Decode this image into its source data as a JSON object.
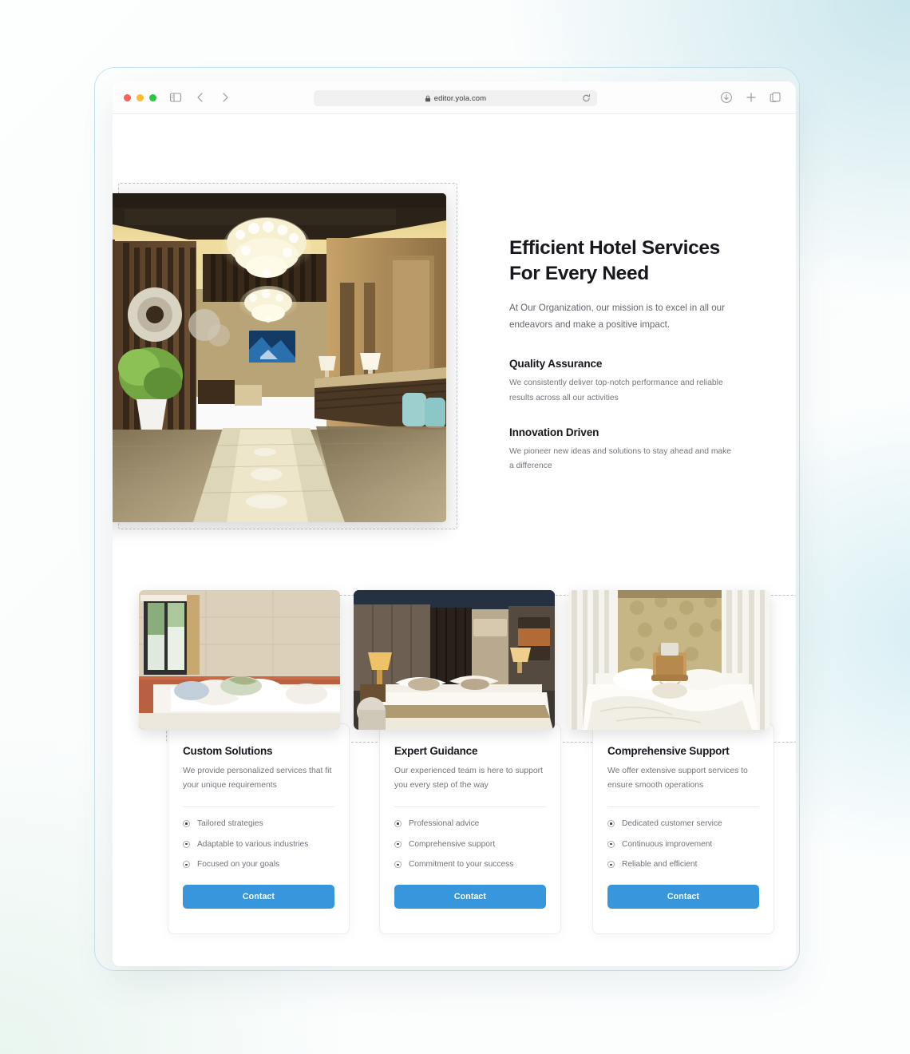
{
  "browser": {
    "url": "editor.yola.com",
    "traffic_lights": [
      "close-red",
      "minimize-yellow",
      "maximize-green"
    ],
    "icons": {
      "sidebar": "sidebar-toggle-icon",
      "back": "back-chevron-icon",
      "forward": "forward-chevron-icon",
      "shield": "shield-icon",
      "lock": "lock-icon",
      "reload": "reload-icon",
      "download": "download-icon",
      "new_tab": "plus-icon",
      "tab_overview": "tab-overview-icon"
    }
  },
  "hero": {
    "heading_line1": "Efficient Hotel Services",
    "heading_line2": "For Every Need",
    "subtitle": "At Our Organization, our mission is to excel in all our endeavors and make a positive impact.",
    "image_alt": "luxury-hotel-lobby-with-chandeliers",
    "features": [
      {
        "title": "Quality Assurance",
        "text": "We consistently deliver top-notch performance and reliable results across all our activities"
      },
      {
        "title": "Innovation Driven",
        "text": "We pioneer new ideas and solutions to stay ahead and make a difference"
      }
    ]
  },
  "cards": [
    {
      "image_alt": "bright-hotel-bedroom-with-window",
      "title": "Custom Solutions",
      "description": "We provide personalized services that fit your unique requirements",
      "items": [
        "Tailored strategies",
        "Adaptable to various industries",
        "Focused on your goals"
      ],
      "button_label": "Contact"
    },
    {
      "image_alt": "modern-hotel-suite-with-lamps",
      "title": "Expert Guidance",
      "description": "Our experienced team is here to support you every step of the way",
      "items": [
        "Professional advice",
        "Comprehensive support",
        "Commitment to your success"
      ],
      "button_label": "Contact"
    },
    {
      "image_alt": "canopy-bed-with-white-linens",
      "title": "Comprehensive Support",
      "description": "We offer extensive support services to ensure smooth operations",
      "items": [
        "Dedicated customer service",
        "Continuous improvement",
        "Reliable and efficient"
      ],
      "button_label": "Contact"
    }
  ],
  "colors": {
    "accent_button": "#3897dc",
    "heading": "#16181d",
    "body_text": "#74767d",
    "selection_dash": "#c2c2c2",
    "frame_border": "#c5e2ef"
  }
}
